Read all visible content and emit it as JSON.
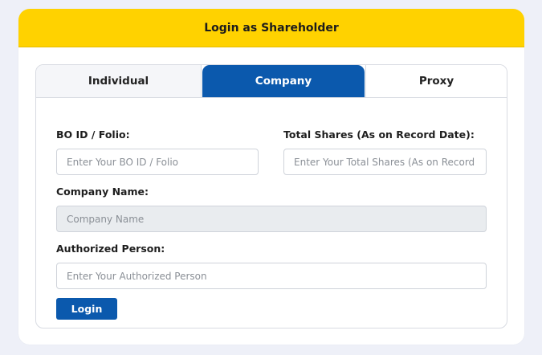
{
  "header": {
    "title": "Login as Shareholder"
  },
  "tabs": [
    {
      "label": "Individual",
      "active": false
    },
    {
      "label": "Company",
      "active": true
    },
    {
      "label": "Proxy",
      "active": false
    }
  ],
  "form": {
    "bo_id": {
      "label": "BO ID / Folio:",
      "placeholder": "Enter Your BO ID / Folio",
      "value": ""
    },
    "total_shares": {
      "label": "Total Shares (As on Record Date):",
      "placeholder": "Enter Your Total Shares (As on Record Date)",
      "value": ""
    },
    "company_name": {
      "label": "Company Name:",
      "placeholder": "Company Name",
      "value": ""
    },
    "authorized_person": {
      "label": "Authorized Person:",
      "placeholder": "Enter Your Authorized Person",
      "value": ""
    },
    "submit_label": "Login"
  },
  "colors": {
    "header_bg": "#ffd200",
    "active_tab_bg": "#0b59ad",
    "button_bg": "#0b59ad",
    "page_bg": "#eef0f8"
  }
}
